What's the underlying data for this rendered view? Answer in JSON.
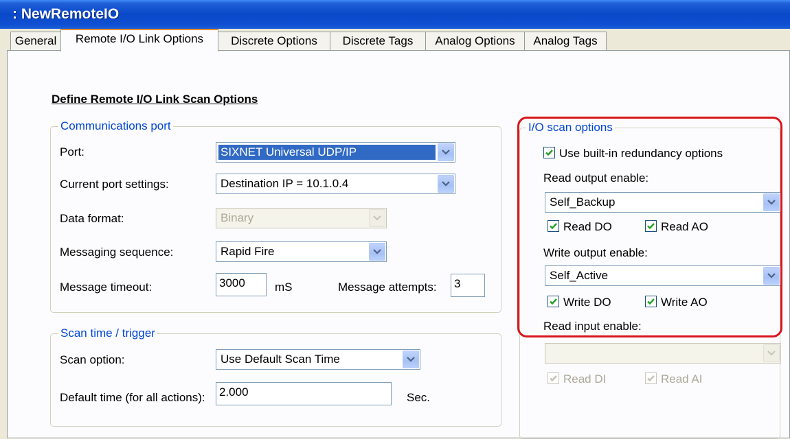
{
  "window": {
    "title": ": NewRemoteIO"
  },
  "tabs": [
    {
      "label": "General"
    },
    {
      "label": "Remote I/O Link Options"
    },
    {
      "label": "Discrete Options"
    },
    {
      "label": "Discrete Tags"
    },
    {
      "label": "Analog Options"
    },
    {
      "label": "Analog Tags"
    }
  ],
  "active_tab": "Remote I/O Link Options",
  "heading": "Define Remote I/O Link Scan Options",
  "comm": {
    "legend": "Communications port",
    "port_label": "Port:",
    "port_value": "SIXNET Universal UDP/IP",
    "settings_label": "Current port settings:",
    "settings_value": "Destination IP = 10.1.0.4",
    "format_label": "Data format:",
    "format_value": "Binary",
    "sequence_label": "Messaging sequence:",
    "sequence_value": "Rapid Fire",
    "timeout_label": "Message timeout:",
    "timeout_value": "3000",
    "timeout_unit": "mS",
    "attempts_label": "Message attempts:",
    "attempts_value": "3"
  },
  "scan": {
    "legend": "Scan time / trigger",
    "option_label": "Scan option:",
    "option_value": "Use Default Scan Time",
    "default_label": "Default time (for all actions):",
    "default_value": "2.000",
    "default_unit": "Sec."
  },
  "io": {
    "legend": "I/O scan options",
    "redundancy_label": "Use built-in redundancy options",
    "redundancy_checked": true,
    "read_output_label": "Read output enable:",
    "read_output_value": "Self_Backup",
    "read_do_label": "Read DO",
    "read_ao_label": "Read AO",
    "write_output_label": "Write output enable:",
    "write_output_value": "Self_Active",
    "write_do_label": "Write DO",
    "write_ao_label": "Write AO",
    "read_input_label": "Read input enable:",
    "read_input_value": "",
    "read_di_label": "Read DI",
    "read_ai_label": "Read AI"
  },
  "colors": {
    "titlebar": "#0a48c9",
    "highlight": "#d7161b",
    "selection": "#316ac5",
    "group_legend": "#0046d5"
  }
}
